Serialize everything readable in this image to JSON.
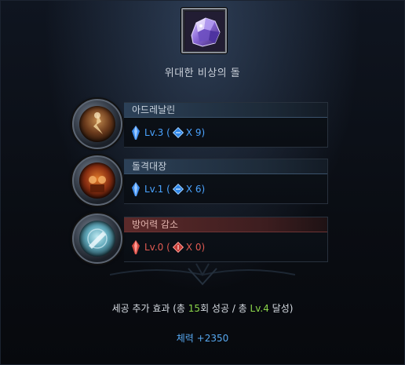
{
  "item": {
    "title": "위대한 비상의 돌",
    "icon": "purple-crystal-stone-icon"
  },
  "skills": [
    {
      "name": "아드레날린",
      "theme": "blue",
      "level_text": "Lv.3",
      "count_text": "X 9",
      "gem_icon": "blue-gem-icon",
      "skill_icon": "adrenaline-skill-icon"
    },
    {
      "name": "돌격대장",
      "theme": "blue",
      "level_text": "Lv.1",
      "count_text": "X 6",
      "gem_icon": "blue-gem-icon",
      "skill_icon": "assault-captain-skill-icon"
    },
    {
      "name": "방어력 감소",
      "theme": "red",
      "level_text": "Lv.0",
      "count_text": "X 0",
      "gem_icon": "red-gem-icon",
      "skill_icon": "defense-reduction-skill-icon"
    }
  ],
  "bonus": {
    "prefix": "세공 추가 효과 (총 ",
    "success_count": "15",
    "middle": "회 성공 / 총 ",
    "total_level": "Lv.4",
    "suffix": " 달성)",
    "stat": "체력 +2350"
  },
  "colors": {
    "accent_blue": "#4aa3ff",
    "accent_red": "#e05a52",
    "accent_green": "#8bd64a"
  }
}
